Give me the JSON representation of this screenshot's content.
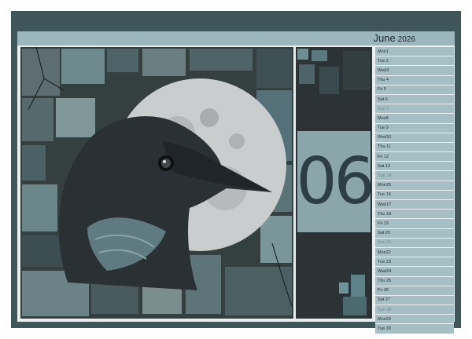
{
  "calendar": {
    "month": "June",
    "year": "2026",
    "month_number": "06"
  },
  "days": [
    {
      "label": "Mon1"
    },
    {
      "label": "Tue 2"
    },
    {
      "label": "Wed3"
    },
    {
      "label": "Thu 4"
    },
    {
      "label": "Fri   5"
    },
    {
      "label": "Sat  6"
    },
    {
      "label": "Sun 7",
      "sunday": true
    },
    {
      "label": "Mon8"
    },
    {
      "label": "Tue 9"
    },
    {
      "label": "Wed10"
    },
    {
      "label": "Thu 11"
    },
    {
      "label": "Fri   12"
    },
    {
      "label": "Sat  13"
    },
    {
      "label": "Sun 14",
      "sunday": true
    },
    {
      "label": "Mon15"
    },
    {
      "label": "Tue 16"
    },
    {
      "label": "Wed17"
    },
    {
      "label": "Thu 18"
    },
    {
      "label": "Fri   19"
    },
    {
      "label": "Sat  20"
    },
    {
      "label": "Sun 21",
      "sunday": true
    },
    {
      "label": "Mon22"
    },
    {
      "label": "Tue 23"
    },
    {
      "label": "Wed24"
    },
    {
      "label": "Thu 25"
    },
    {
      "label": "Fri   26"
    },
    {
      "label": "Sat  27"
    },
    {
      "label": "Sun 28",
      "sunday": true
    },
    {
      "label": "Mon29"
    },
    {
      "label": "Tue 30"
    }
  ],
  "colors": {
    "frame": "#3e5559",
    "accent": "#9cb6bd",
    "number": "#2d3f44"
  }
}
